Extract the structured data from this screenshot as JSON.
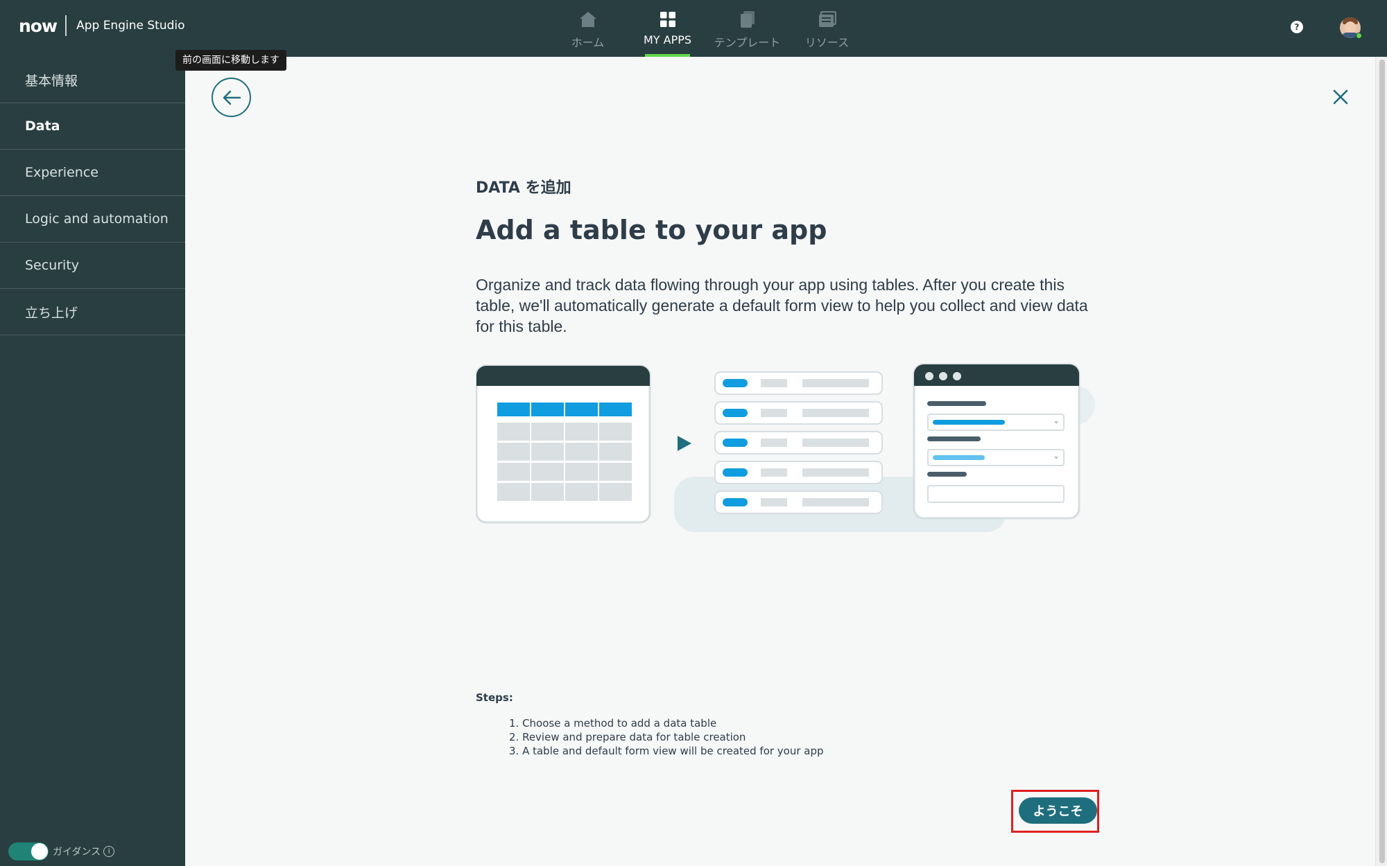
{
  "header": {
    "logo_text": "now",
    "app_name": "App Engine Studio",
    "tabs": [
      {
        "label": "ホーム",
        "icon": "home-icon"
      },
      {
        "label": "MY APPS",
        "icon": "grid-icon"
      },
      {
        "label": "テンプレート",
        "icon": "template-icon"
      },
      {
        "label": "リソース",
        "icon": "resources-icon"
      }
    ],
    "active_tab": "MY APPS",
    "help_glyph": "?"
  },
  "sidebar": {
    "items": [
      {
        "label": "基本情報"
      },
      {
        "label": "Data"
      },
      {
        "label": "Experience"
      },
      {
        "label": "Logic and automation"
      },
      {
        "label": "Security"
      },
      {
        "label": "立ち上げ"
      }
    ],
    "active_item": "Data",
    "guidance_label": "ガイダンス",
    "guidance_on": true
  },
  "tooltip": {
    "text": "前の画面に移動します"
  },
  "content": {
    "kicker": "DATA を追加",
    "title": "Add a table to your app",
    "description": "Organize and track data flowing through your app using tables. After you create this table, we'll automatically generate a default form view to help you collect and view data for this table.",
    "steps_title": "Steps:",
    "steps": [
      "1. Choose a method to add a data table",
      "2. Review and prepare data for table creation",
      "3. A table and default form view will be created for your app"
    ],
    "cta_label": "ようこそ"
  },
  "colors": {
    "topbar": "#293e40",
    "accent_green": "#62d84e",
    "primary_teal": "#1f6e7e",
    "illustration_blue": "#0f9ddf",
    "highlight_red": "#e02020"
  }
}
